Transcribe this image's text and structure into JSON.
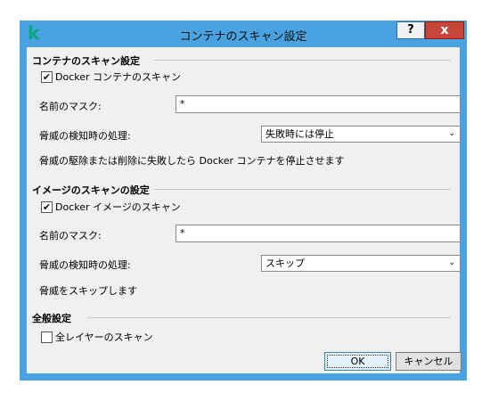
{
  "window": {
    "title": "コンテナのスキャン設定",
    "logo": "k",
    "help_label": "?",
    "close_label": "x"
  },
  "container_section": {
    "title": "コンテナのスキャン設定",
    "checkbox_label": "Docker コンテナのスキャン",
    "checked": true,
    "mask_label": "名前のマスク:",
    "mask_value": "*",
    "action_label": "脅威の検知時の処理:",
    "action_value": "失敗時には停止",
    "description": "脅威の駆除または削除に失敗したら Docker コンテナを停止させます"
  },
  "image_section": {
    "title": "イメージのスキャンの設定",
    "checkbox_label": "Docker イメージのスキャン",
    "checked": true,
    "mask_label": "名前のマスク:",
    "mask_value": "*",
    "action_label": "脅威の検知時の処理:",
    "action_value": "スキップ",
    "description": "脅威をスキップします"
  },
  "general_section": {
    "title": "全般設定",
    "checkbox_label": "全レイヤーのスキャン",
    "checked": false
  },
  "buttons": {
    "ok": "OK",
    "cancel": "キャンセル"
  },
  "icons": {
    "checkmark": "✔",
    "dropdown": "⌄"
  },
  "colors": {
    "title_bar": "#4aa3e0",
    "logo": "#07a67b",
    "close_button": "#c7463a"
  }
}
